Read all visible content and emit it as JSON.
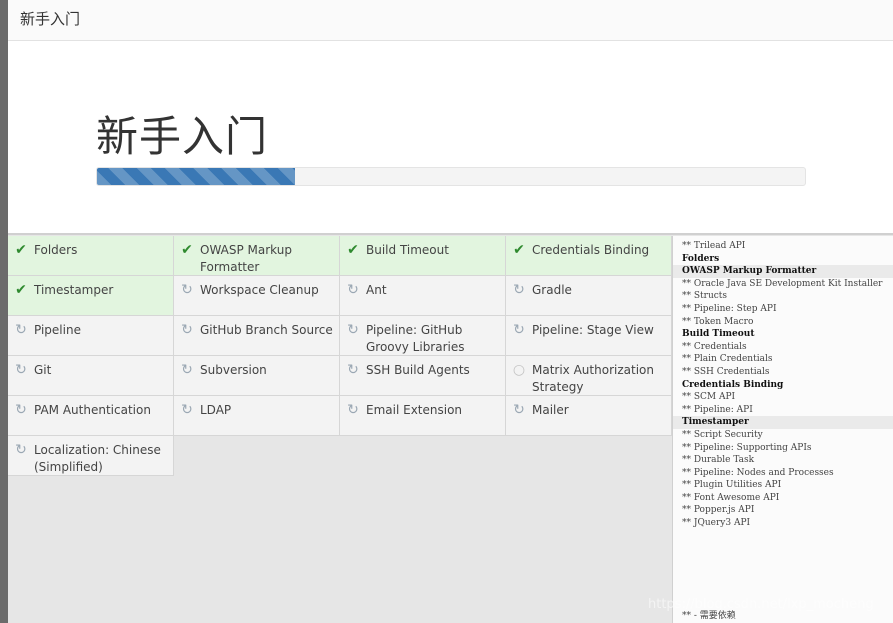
{
  "window": {
    "title": "新手入门"
  },
  "hero": {
    "title": "新手入门",
    "progress_percent": 28
  },
  "plugins": [
    {
      "label": "Folders",
      "status": "done"
    },
    {
      "label": "OWASP Markup Formatter",
      "status": "done"
    },
    {
      "label": "Build Timeout",
      "status": "done"
    },
    {
      "label": "Credentials Binding",
      "status": "done"
    },
    {
      "label": "Timestamper",
      "status": "done"
    },
    {
      "label": "Workspace Cleanup",
      "status": "installing"
    },
    {
      "label": "Ant",
      "status": "installing"
    },
    {
      "label": "Gradle",
      "status": "installing"
    },
    {
      "label": "Pipeline",
      "status": "installing"
    },
    {
      "label": "GitHub Branch Source",
      "status": "installing"
    },
    {
      "label": "Pipeline: GitHub Groovy Libraries",
      "status": "installing"
    },
    {
      "label": "Pipeline: Stage View",
      "status": "installing"
    },
    {
      "label": "Git",
      "status": "installing"
    },
    {
      "label": "Subversion",
      "status": "installing"
    },
    {
      "label": "SSH Build Agents",
      "status": "installing"
    },
    {
      "label": "Matrix Authorization Strategy",
      "status": "pending"
    },
    {
      "label": "PAM Authentication",
      "status": "installing"
    },
    {
      "label": "LDAP",
      "status": "installing"
    },
    {
      "label": "Email Extension",
      "status": "installing"
    },
    {
      "label": "Mailer",
      "status": "installing"
    },
    {
      "label": "Localization: Chinese (Simplified)",
      "status": "installing"
    }
  ],
  "log": [
    {
      "text": "** Trilead API",
      "type": "dep"
    },
    {
      "text": "Folders",
      "type": "header"
    },
    {
      "text": "OWASP Markup Formatter",
      "type": "header",
      "highlight": true
    },
    {
      "text": "** Oracle Java SE Development Kit Installer",
      "type": "dep"
    },
    {
      "text": "** Structs",
      "type": "dep"
    },
    {
      "text": "** Pipeline: Step API",
      "type": "dep"
    },
    {
      "text": "** Token Macro",
      "type": "dep"
    },
    {
      "text": "Build Timeout",
      "type": "header"
    },
    {
      "text": "** Credentials",
      "type": "dep"
    },
    {
      "text": "** Plain Credentials",
      "type": "dep"
    },
    {
      "text": "** SSH Credentials",
      "type": "dep"
    },
    {
      "text": "Credentials Binding",
      "type": "header"
    },
    {
      "text": "** SCM API",
      "type": "dep"
    },
    {
      "text": "** Pipeline: API",
      "type": "dep"
    },
    {
      "text": "Timestamper",
      "type": "header",
      "highlight": true
    },
    {
      "text": "** Script Security",
      "type": "dep"
    },
    {
      "text": "** Pipeline: Supporting APIs",
      "type": "dep"
    },
    {
      "text": "** Durable Task",
      "type": "dep"
    },
    {
      "text": "** Pipeline: Nodes and Processes",
      "type": "dep"
    },
    {
      "text": "** Plugin Utilities API",
      "type": "dep"
    },
    {
      "text": "** Font Awesome API",
      "type": "dep"
    },
    {
      "text": "** Popper.js API",
      "type": "dep"
    },
    {
      "text": "** JQuery3 API",
      "type": "dep"
    }
  ],
  "log_footer": "** - 需要依赖",
  "watermark": "https://blog.csdn.net/lxp_mocheng",
  "colors": {
    "done_bg": "#e2f5df",
    "check": "#2f8a2f",
    "progress": "#3a78b5"
  },
  "icons": {
    "done": "check-icon",
    "installing": "refresh-icon",
    "pending": "circle-icon"
  }
}
